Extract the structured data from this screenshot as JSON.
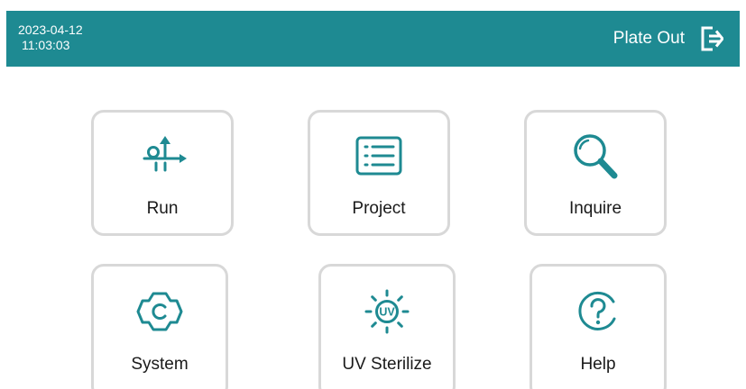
{
  "header": {
    "date": "2023-04-12",
    "time": "11:03:03",
    "plate_out_label": "Plate Out",
    "plate_out_icon": "exit-arrow-icon",
    "background_color": "#1e8a92"
  },
  "menu": {
    "accent_color": "#1e8a92",
    "tiles": [
      {
        "label": "Run",
        "icon": "run-route-icon"
      },
      {
        "label": "Project",
        "icon": "list-document-icon"
      },
      {
        "label": "Inquire",
        "icon": "magnifier-icon"
      },
      {
        "label": "System",
        "icon": "gear-icon"
      },
      {
        "label": "UV Sterilize",
        "icon": "uv-sun-icon"
      },
      {
        "label": "Help",
        "icon": "question-circle-icon"
      }
    ]
  }
}
